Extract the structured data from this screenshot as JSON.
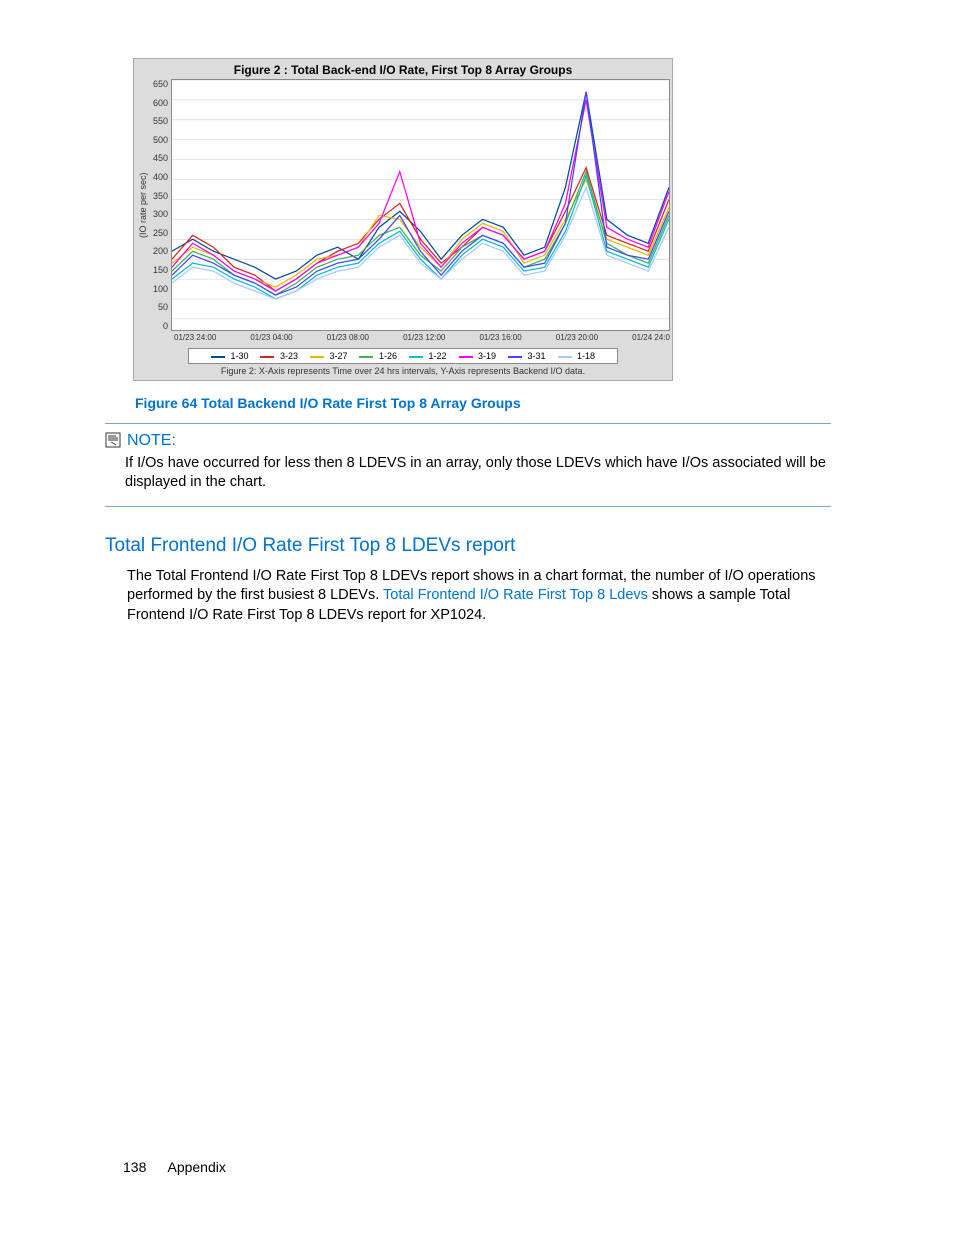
{
  "figure_caption": "Figure 64 Total Backend I/O Rate First Top 8 Array Groups",
  "note": {
    "label": "NOTE:",
    "text": "If I/Os have occurred for less then 8 LDEVS in an array, only those LDEVs which have I/Os associated will be displayed in the chart."
  },
  "section_heading": "Total Frontend I/O Rate First Top 8 LDEVs report",
  "body": {
    "p1a": "The Total Frontend I/O Rate First Top 8 LDEVs report shows in a chart format, the number of I/O operations performed by the first busiest 8 LDEVs.  ",
    "link": "Total Frontend I/O Rate First Top 8 Ldevs",
    "p1b": " shows a sample Total Frontend I/O Rate First Top 8 LDEVs report for XP1024."
  },
  "footer": {
    "page": "138",
    "section": "Appendix"
  },
  "chart_data": {
    "type": "line",
    "title": "Figure 2 : Total Back-end I/O Rate, First Top 8 Array Groups",
    "ylabel": "(IO rate per sec)",
    "ylim": [
      0,
      650
    ],
    "y_ticks": [
      "650",
      "600",
      "550",
      "500",
      "450",
      "400",
      "350",
      "300",
      "250",
      "200",
      "150",
      "100",
      "50",
      "0"
    ],
    "x_ticks": [
      "01/23 24:00",
      "01/23 04:00",
      "01/23 08:00",
      "01/23 12:00",
      "01/23 16:00",
      "01/23 20:00",
      "01/24 24:0"
    ],
    "footnote": "Figure 2: X-Axis represents Time over 24 hrs intervals, Y-Axis represents Backend I/O data.",
    "legend": [
      {
        "name": "1-30",
        "color": "#004b9b"
      },
      {
        "name": "3-23",
        "color": "#d22"
      },
      {
        "name": "3-27",
        "color": "#e6b800"
      },
      {
        "name": "1-26",
        "color": "#3cb44b"
      },
      {
        "name": "1-22",
        "color": "#00bcd4"
      },
      {
        "name": "3-19",
        "color": "#ff00ff"
      },
      {
        "name": "3-31",
        "color": "#4444ff"
      },
      {
        "name": "1-18",
        "color": "#a8c8ff"
      }
    ],
    "x": [
      0,
      1,
      2,
      3,
      4,
      5,
      6,
      7,
      8,
      9,
      10,
      11,
      12,
      13,
      14,
      15,
      16,
      17,
      18,
      19,
      20,
      21,
      22,
      23,
      24
    ],
    "series": [
      {
        "name": "1-30",
        "color": "#004b9b",
        "values": [
          220,
          250,
          220,
          200,
          180,
          150,
          170,
          210,
          230,
          200,
          280,
          320,
          270,
          200,
          260,
          300,
          280,
          210,
          230,
          380,
          620,
          300,
          260,
          240,
          380
        ]
      },
      {
        "name": "3-23",
        "color": "#d22",
        "values": [
          200,
          260,
          230,
          180,
          160,
          120,
          150,
          190,
          220,
          240,
          300,
          340,
          250,
          190,
          230,
          280,
          260,
          200,
          220,
          320,
          430,
          260,
          240,
          220,
          350
        ]
      },
      {
        "name": "3-27",
        "color": "#e6b800",
        "values": [
          190,
          230,
          210,
          170,
          150,
          130,
          160,
          200,
          210,
          230,
          310,
          300,
          230,
          180,
          250,
          290,
          270,
          190,
          210,
          300,
          400,
          250,
          230,
          210,
          330
        ]
      },
      {
        "name": "1-26",
        "color": "#3cb44b",
        "values": [
          170,
          220,
          200,
          160,
          140,
          110,
          140,
          180,
          200,
          210,
          260,
          280,
          210,
          170,
          230,
          260,
          240,
          180,
          200,
          290,
          420,
          240,
          210,
          190,
          310
        ]
      },
      {
        "name": "1-22",
        "color": "#00bcd4",
        "values": [
          150,
          190,
          180,
          150,
          130,
          100,
          120,
          160,
          180,
          190,
          240,
          270,
          200,
          150,
          210,
          250,
          230,
          170,
          180,
          270,
          410,
          220,
          200,
          180,
          300
        ]
      },
      {
        "name": "3-19",
        "color": "#ff00ff",
        "values": [
          180,
          240,
          210,
          170,
          150,
          120,
          150,
          190,
          210,
          230,
          290,
          420,
          240,
          180,
          240,
          280,
          260,
          200,
          220,
          340,
          600,
          280,
          250,
          230,
          370
        ]
      },
      {
        "name": "3-31",
        "color": "#4444ff",
        "values": [
          160,
          210,
          190,
          160,
          140,
          110,
          130,
          170,
          190,
          200,
          250,
          310,
          220,
          160,
          220,
          260,
          240,
          180,
          190,
          290,
          620,
          230,
          210,
          200,
          320
        ]
      },
      {
        "name": "1-18",
        "color": "#a8c8ff",
        "values": [
          140,
          180,
          170,
          140,
          120,
          100,
          120,
          150,
          170,
          180,
          230,
          260,
          190,
          150,
          200,
          240,
          220,
          160,
          170,
          260,
          380,
          210,
          190,
          170,
          280
        ]
      }
    ]
  }
}
